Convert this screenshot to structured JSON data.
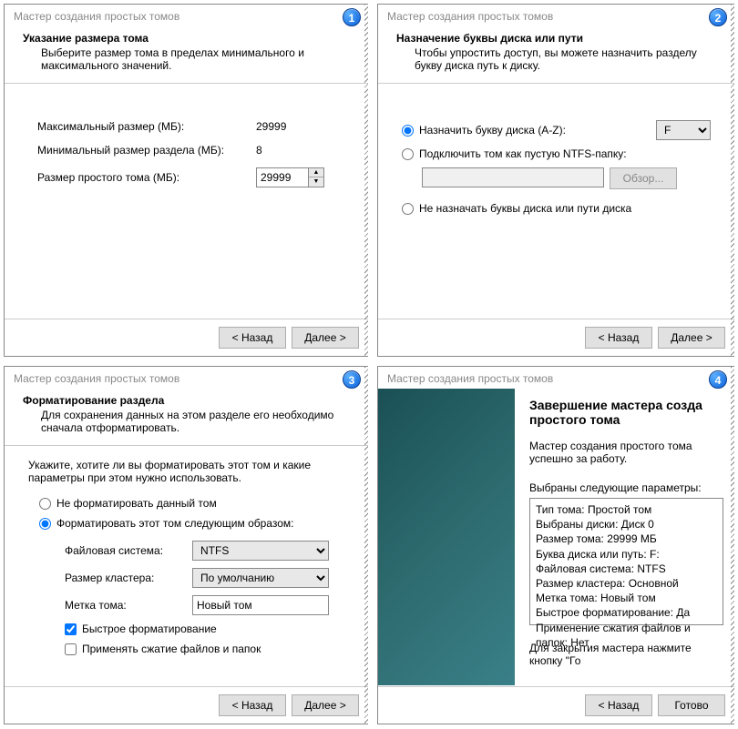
{
  "common": {
    "wizard_title": "Мастер создания простых томов",
    "back": "< Назад",
    "next": "Далее >",
    "finish": "Готово",
    "browse": "Обзор..."
  },
  "panel1": {
    "badge": "1",
    "title": "Указание размера тома",
    "desc": "Выберите размер тома в пределах минимального и максимального значений.",
    "max_label": "Максимальный размер (МБ):",
    "max_value": "29999",
    "min_label": "Минимальный размер раздела (МБ):",
    "min_value": "8",
    "size_label": "Размер простого тома (МБ):",
    "size_value": "29999"
  },
  "panel2": {
    "badge": "2",
    "title": "Назначение буквы диска или пути",
    "desc": "Чтобы упростить доступ, вы можете назначить разделу букву диска путь к диску.",
    "opt_assign": "Назначить букву диска (A-Z):",
    "drive_letter": "F",
    "opt_mount": "Подключить том как пустую NTFS-папку:",
    "opt_none": "Не назначать буквы диска или пути диска"
  },
  "panel3": {
    "badge": "3",
    "title": "Форматирование раздела",
    "desc": "Для сохранения данных на этом разделе его необходимо сначала отформатировать.",
    "instruction": "Укажите, хотите ли вы форматировать этот том и какие параметры при этом нужно использовать.",
    "opt_noformat": "Не форматировать данный том",
    "opt_format": "Форматировать этот том следующим образом:",
    "fs_label": "Файловая система:",
    "fs_value": "NTFS",
    "cluster_label": "Размер кластера:",
    "cluster_value": "По умолчанию",
    "vol_label": "Метка тома:",
    "vol_value": "Новый том",
    "quick_format": "Быстрое форматирование",
    "compress": "Применять сжатие файлов и папок"
  },
  "panel4": {
    "badge": "4",
    "title": "Завершение мастера созда простого тома",
    "done_msg": "Мастер создания простого тома успешно за работу.",
    "params_label": "Выбраны следующие параметры:",
    "summary": [
      "Тип тома: Простой том",
      "Выбраны диски: Диск 0",
      "Размер тома: 29999 МБ",
      "Буква диска или путь: F:",
      "Файловая система: NTFS",
      "Размер кластера: Основной",
      "Метка тома: Новый том",
      "Быстрое форматирование: Да",
      "Применение сжатия файлов и папок: Нет"
    ],
    "close_hint": "Для закрытия мастера нажмите кнопку \"Го"
  }
}
